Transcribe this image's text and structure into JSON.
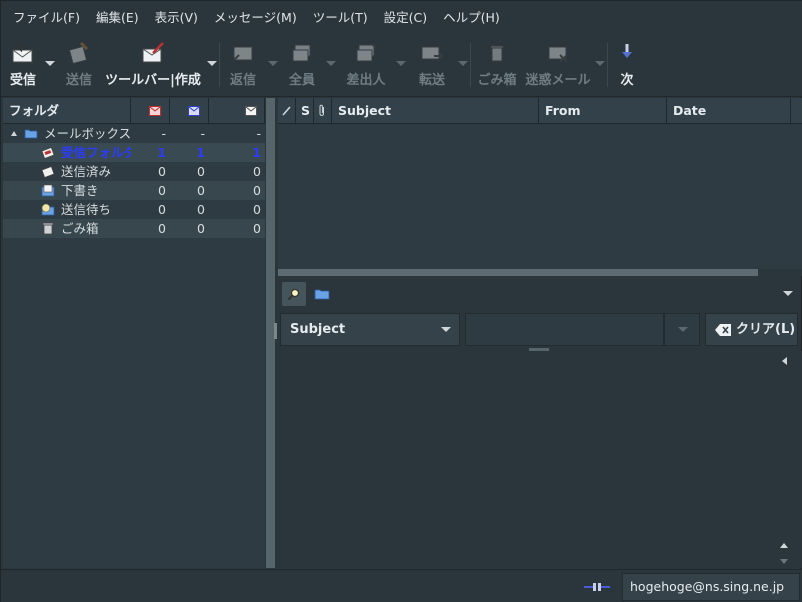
{
  "menubar": {
    "items": [
      "ファイル(F)",
      "編集(E)",
      "表示(V)",
      "メッセージ(M)",
      "ツール(T)",
      "設定(C)",
      "ヘルプ(H)"
    ]
  },
  "toolbar": {
    "receive": "受信",
    "send": "送信",
    "compose": "ツールバー|作成",
    "reply": "返信",
    "reply_all": "全員",
    "sender": "差出人",
    "forward": "転送",
    "trash": "ごみ箱",
    "spam": "迷惑メール",
    "next": "次"
  },
  "folder_pane": {
    "header": "フォルダ",
    "rows": [
      {
        "name": "メールボックス",
        "new": "-",
        "unread": "-",
        "total": "-"
      },
      {
        "name": "受信フォルダ",
        "new": "1",
        "unread": "1",
        "total": "1"
      },
      {
        "name": "送信済み",
        "new": "0",
        "unread": "0",
        "total": "0"
      },
      {
        "name": "下書き",
        "new": "0",
        "unread": "0",
        "total": "0"
      },
      {
        "name": "送信待ち",
        "new": "0",
        "unread": "0",
        "total": "0"
      },
      {
        "name": "ごみ箱",
        "new": "0",
        "unread": "0",
        "total": "0"
      }
    ]
  },
  "message_list": {
    "col_mark": "S",
    "col_subject": "Subject",
    "col_from": "From",
    "col_date": "Date"
  },
  "search": {
    "field": "Subject",
    "value": "",
    "clear": "クリア(L)"
  },
  "statusbar": {
    "account": "hogehoge@ns.sing.ne.jp"
  },
  "colors": {
    "background": "#2b363c",
    "unread": "#2b3cff"
  }
}
